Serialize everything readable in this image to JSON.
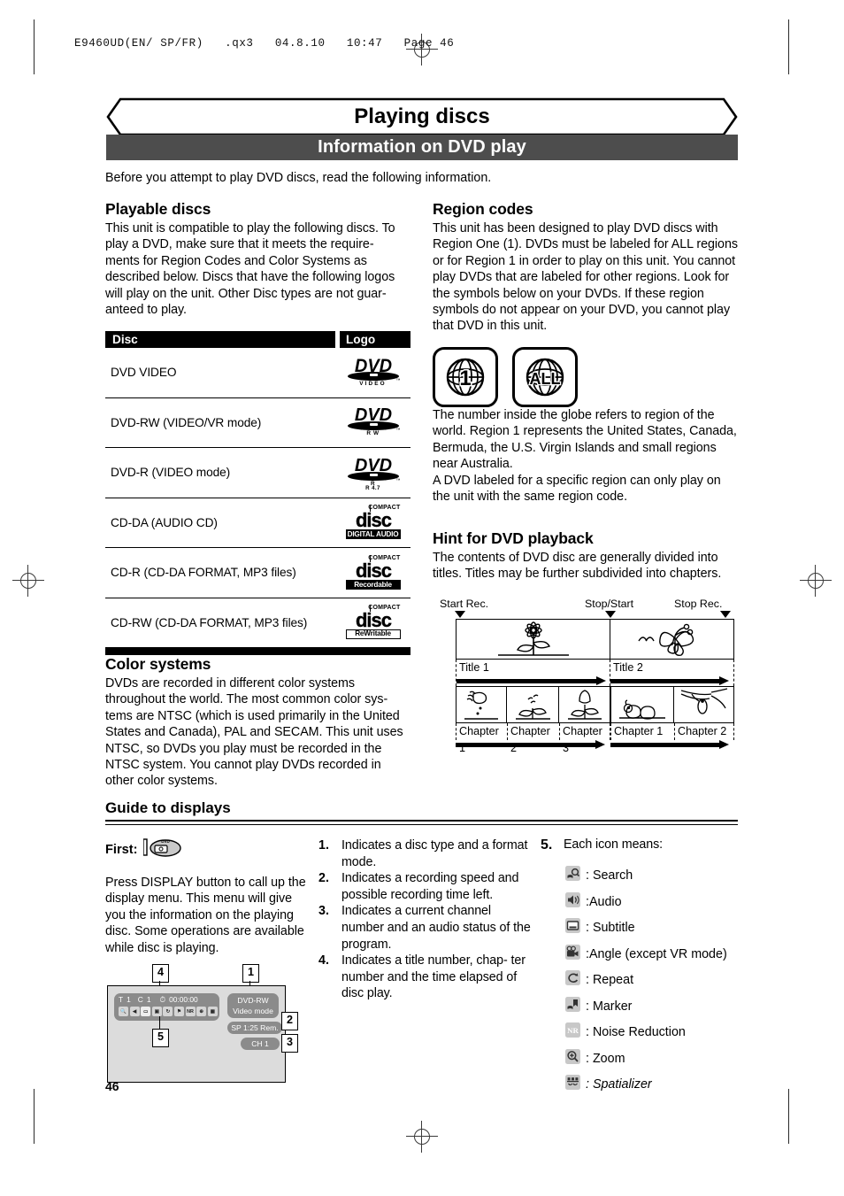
{
  "print_header": "E9460UD(EN/ SP/FR)   .qx3   04.8.10   10:47   Page 46",
  "banner_title": "Playing discs",
  "section_bar": "Information on DVD play",
  "intro": "Before you attempt to play DVD discs, read the following information.",
  "page_number": "46",
  "left_column": {
    "playable": {
      "heading": "Playable discs",
      "body": "This unit is compatible to play the following discs. To play a DVD, make sure that it meets the require- ments for Region Codes and Color Systems as described below. Discs that have the following logos will play on the unit. Other Disc types are not guar- anteed to play."
    },
    "table": {
      "headers": [
        "Disc",
        "Logo"
      ],
      "rows": [
        {
          "name": "DVD VIDEO",
          "logo": "dvd-video-logo",
          "logo_main": "DVD",
          "logo_sub": "VIDEO"
        },
        {
          "name": "DVD-RW (VIDEO/VR mode)",
          "logo": "dvd-rw-logo",
          "logo_main": "DVD",
          "logo_sub": "R W"
        },
        {
          "name": "DVD-R (VIDEO mode)",
          "logo": "dvd-r-logo",
          "logo_main": "DVD",
          "logo_sub": "R",
          "logo_sub2": "R 4.7"
        },
        {
          "name": "CD-DA (AUDIO CD)",
          "logo": "compact-disc-digital-audio-logo",
          "logo_top": "COMPACT",
          "logo_tag": "DIGITAL AUDIO"
        },
        {
          "name": "CD-R (CD-DA FORMAT, MP3 files)",
          "logo": "compact-disc-recordable-logo",
          "logo_top": "COMPACT",
          "logo_tag": "Recordable"
        },
        {
          "name": "CD-RW (CD-DA FORMAT, MP3 files)",
          "logo": "compact-disc-rewritable-logo",
          "logo_top": "COMPACT",
          "logo_tag": "ReWritable"
        }
      ]
    },
    "color_systems": {
      "heading": "Color systems",
      "body": "DVDs are recorded in different color systems throughout the world. The most common color sys- tems are NTSC (which is used primarily in the United States and Canada), PAL and SECAM. This unit uses NTSC, so DVDs you play must be recorded in the NTSC system. You cannot play DVDs recorded in other color systems."
    }
  },
  "right_column": {
    "region_codes": {
      "heading": "Region codes",
      "body": "This unit has been designed to play DVD discs with Region One (1). DVDs must be labeled for ALL regions or for Region 1 in order to play on this unit. You cannot play DVDs that are labeled for other regions. Look for the symbols below on your DVDs. If these region symbols do not appear on your DVD, you cannot play that DVD in this unit.",
      "symbols": [
        "1",
        "ALL"
      ],
      "body2": "The number inside the globe refers to region of the world. Region 1 represents the United States, Canada, Bermuda, the U.S. Virgin Islands and small regions near Australia.",
      "body3": "A DVD labeled for a specific region can only play on the unit with the same region code."
    },
    "hint": {
      "heading": "Hint for DVD playback",
      "body": "The contents of DVD disc are generally divided into titles. Titles may be further subdivided into chapters.",
      "markers": [
        "Start Rec.",
        "Stop/Start",
        "Stop Rec."
      ],
      "titles": [
        "Title 1",
        "Title 2"
      ],
      "chapters_t1": [
        "Chapter 1",
        "Chapter 2",
        "Chapter 3"
      ],
      "chapters_t2": [
        "Chapter 1",
        "Chapter 2"
      ]
    }
  },
  "guide": {
    "heading": "Guide to displays",
    "first_label": "First:",
    "first_body": "Press DISPLAY button to call up the display menu. This menu will give you the information on the playing disc. Some operations are available while disc is playing.",
    "numbered": [
      {
        "n": "1.",
        "text": "Indicates a disc type and a format mode."
      },
      {
        "n": "2.",
        "text": "Indicates a recording speed and possible recording time left."
      },
      {
        "n": "3.",
        "text": "Indicates a current channel number and an audio status of the program."
      },
      {
        "n": "4.",
        "text": "Indicates a title number, chap- ter number and the time elapsed of disc play."
      }
    ],
    "icons_intro_n": "5.",
    "icons_intro": "Each icon means:",
    "icons": [
      {
        "icon": "search-icon",
        "glyph": "⌕",
        "label": ": Search"
      },
      {
        "icon": "audio-icon",
        "glyph": "◂",
        "label": ":Audio"
      },
      {
        "icon": "subtitle-icon",
        "glyph": "▬",
        "label": ": Subtitle"
      },
      {
        "icon": "angle-camera-icon",
        "glyph": "⌘",
        "label": ":Angle (except VR mode)"
      },
      {
        "icon": "repeat-icon",
        "glyph": "↻",
        "label": ": Repeat"
      },
      {
        "icon": "marker-icon",
        "glyph": "⚑",
        "label": ": Marker"
      },
      {
        "icon": "noise-reduction-icon",
        "glyph": "NR",
        "label": ": Noise Reduction"
      },
      {
        "icon": "zoom-icon",
        "glyph": "⊕",
        "label": ": Zoom"
      },
      {
        "icon": "spatializer-icon",
        "glyph": "∴",
        "label": ": Spatializer",
        "italic": true
      }
    ],
    "osd": {
      "title_label": "T",
      "title_value": "1",
      "chapter_label": "C",
      "chapter_value": "1",
      "time_value": "00:00:00",
      "disc_type_line1": "DVD-RW",
      "disc_type_line2": "Video mode",
      "speed": "SP 1:25 Rem.",
      "channel": "CH 1",
      "callouts": [
        "1",
        "2",
        "3",
        "4",
        "5"
      ]
    }
  }
}
